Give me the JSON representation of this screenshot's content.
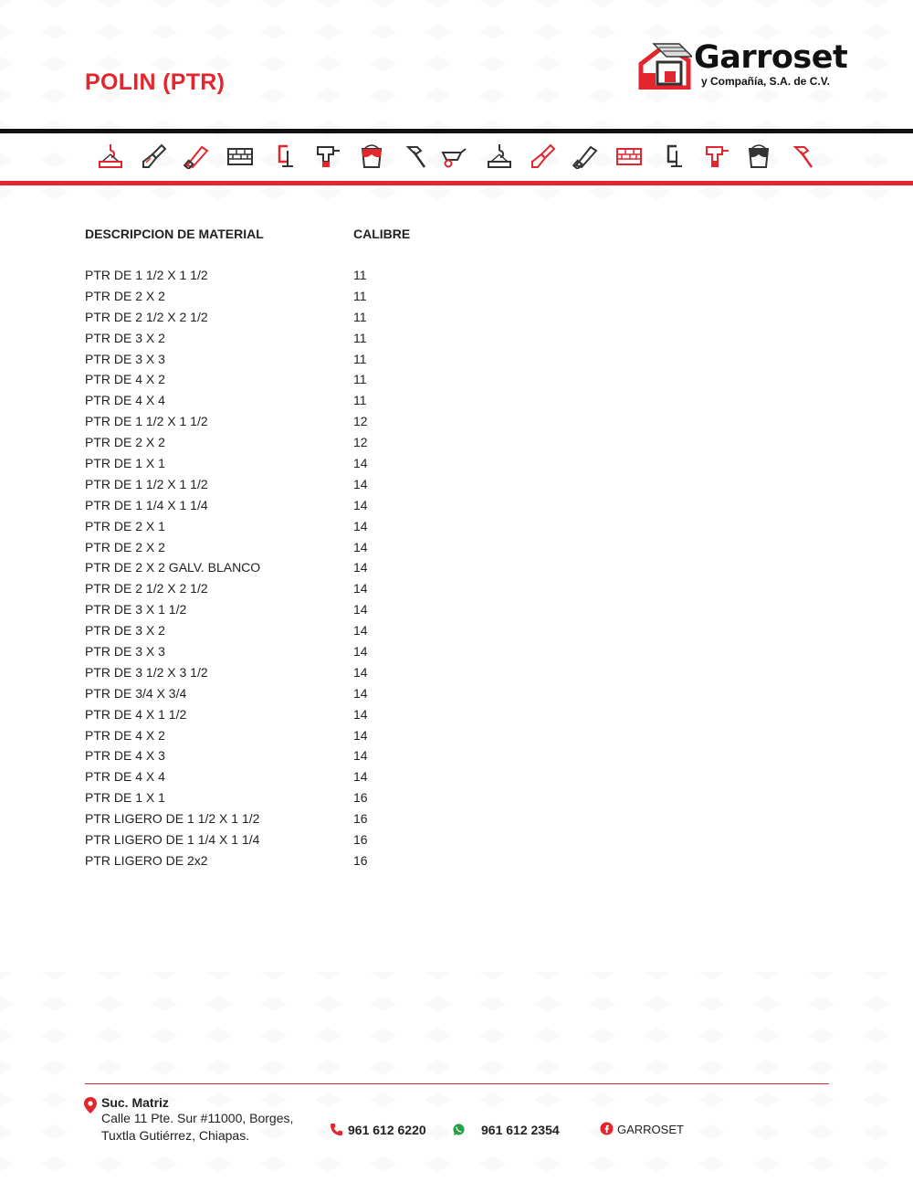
{
  "header": {
    "title": "POLIN (PTR)",
    "logo_name": "Garroset",
    "logo_subtitle": "y Compañía, S.A. de C.V."
  },
  "toolbar_icons": [
    "crane-hook-icon",
    "paint-brush-icon",
    "hand-saw-icon",
    "brick-wall-icon",
    "c-clamp-icon",
    "cordless-drill-icon",
    "paint-bucket-icon",
    "hammer-icon",
    "wheelbarrow-icon",
    "crane-hook-icon",
    "paint-brush-icon",
    "hand-saw-icon",
    "brick-wall-icon",
    "c-clamp-icon",
    "cordless-drill-icon",
    "paint-bucket-icon",
    "hammer-icon"
  ],
  "table": {
    "headers": {
      "description": "DESCRIPCION DE MATERIAL",
      "gauge": "CALIBRE"
    },
    "rows": [
      {
        "description": "PTR DE 1 1/2 X 1 1/2",
        "gauge": "11"
      },
      {
        "description": "PTR DE 2 X 2",
        "gauge": "11"
      },
      {
        "description": "PTR DE 2 1/2 X 2 1/2",
        "gauge": "11"
      },
      {
        "description": "PTR DE 3 X 2",
        "gauge": "11"
      },
      {
        "description": "PTR DE 3 X 3",
        "gauge": "11"
      },
      {
        "description": "PTR DE 4 X 2",
        "gauge": "11"
      },
      {
        "description": "PTR DE 4 X 4",
        "gauge": "11"
      },
      {
        "description": "PTR DE 1 1/2 X 1 1/2",
        "gauge": "12"
      },
      {
        "description": "PTR DE 2 X 2",
        "gauge": "12"
      },
      {
        "description": "PTR DE 1 X 1",
        "gauge": "14"
      },
      {
        "description": "PTR DE 1 1/2 X 1 1/2",
        "gauge": "14"
      },
      {
        "description": "PTR DE 1 1/4 X 1 1/4",
        "gauge": "14"
      },
      {
        "description": "PTR DE 2 X 1",
        "gauge": "14"
      },
      {
        "description": "PTR DE 2 X 2",
        "gauge": "14"
      },
      {
        "description": "PTR DE 2 X 2 GALV. BLANCO",
        "gauge": "14"
      },
      {
        "description": "PTR DE 2 1/2 X 2 1/2",
        "gauge": "14"
      },
      {
        "description": "PTR DE 3 X 1 1/2",
        "gauge": "14"
      },
      {
        "description": "PTR DE 3 X 2",
        "gauge": "14"
      },
      {
        "description": "PTR DE 3 X 3",
        "gauge": "14"
      },
      {
        "description": "PTR DE 3 1/2 X 3 1/2",
        "gauge": "14"
      },
      {
        "description": "PTR DE 3/4 X 3/4",
        "gauge": "14"
      },
      {
        "description": "PTR DE 4 X 1 1/2",
        "gauge": "14"
      },
      {
        "description": "PTR DE 4 X 2",
        "gauge": "14"
      },
      {
        "description": "PTR DE 4 X 3",
        "gauge": "14"
      },
      {
        "description": "PTR DE 4 X 4",
        "gauge": "14"
      },
      {
        "description": "PTR DE 1 X 1",
        "gauge": "16"
      },
      {
        "description": "PTR LIGERO DE 1 1/2 X 1 1/2",
        "gauge": "16"
      },
      {
        "description": "PTR LIGERO DE 1 1/4 X 1 1/4",
        "gauge": "16"
      },
      {
        "description": "PTR LIGERO DE 2x2",
        "gauge": "16"
      }
    ]
  },
  "footer": {
    "branch_title": "Suc. Matriz",
    "address_line1": "Calle 11 Pte. Sur #11000, Borges,",
    "address_line2": "Tuxtla Gutiérrez, Chiapas.",
    "phone": "961 612 6220",
    "whatsapp": "961 612 2354",
    "facebook": "GARROSET"
  },
  "colors": {
    "accent_red": "#e3262d",
    "dark": "#111111",
    "whatsapp_green": "#25a244"
  }
}
